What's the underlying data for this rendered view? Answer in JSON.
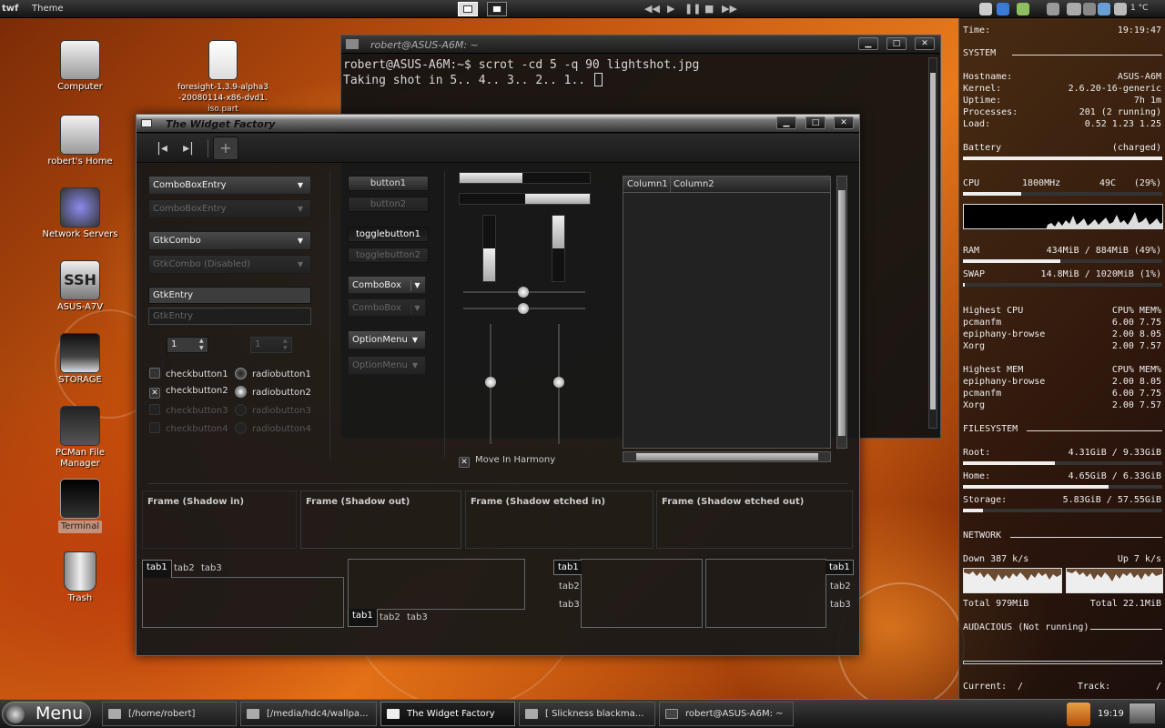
{
  "top_panel": {
    "app_label": "twf",
    "menu_label": "Theme",
    "temperature": "1 °C"
  },
  "desktop_icons": [
    {
      "label": "Computer",
      "icon": "computer-icon"
    },
    {
      "label": "foresight-1.3.9-alpha3-20080114-x86-dvd1.iso.part",
      "icon": "file-icon"
    },
    {
      "label": "robert's Home",
      "icon": "home-folder-icon"
    },
    {
      "label": "Network Servers",
      "icon": "network-icon"
    },
    {
      "label": "ASUS-A7V",
      "icon": "ssh-icon"
    },
    {
      "label": "STORAGE",
      "icon": "drive-icon"
    },
    {
      "label": "PCMan File Manager",
      "icon": "file-manager-icon"
    },
    {
      "label": "Terminal",
      "icon": "terminal-icon"
    },
    {
      "label": "Trash",
      "icon": "trash-icon"
    }
  ],
  "terminal": {
    "title": "robert@ASUS-A6M: ~",
    "lines": [
      "robert@ASUS-A6M:~$ scrot -cd 5 -q 90 lightshot.jpg",
      "Taking shot in 5.. 4.. 3.. 2.. 1.. "
    ]
  },
  "widget_factory": {
    "title": "The Widget Factory",
    "combo_entry": "ComboBoxEntry",
    "combo_entry_disabled": "ComboBoxEntry",
    "gtk_combo": "GtkCombo",
    "gtk_combo_disabled": "GtkCombo (Disabled)",
    "gtk_entry": "GtkEntry",
    "gtk_entry_disabled": "GtkEntry",
    "spin1": "1",
    "spin2": "1",
    "checks": [
      "checkbutton1",
      "checkbutton2",
      "checkbutton3",
      "checkbutton4"
    ],
    "radios": [
      "radiobutton1",
      "radiobutton2",
      "radiobutton3",
      "radiobutton4"
    ],
    "button1": "button1",
    "button2": "button2",
    "toggle1": "togglebutton1",
    "toggle2": "togglebutton2",
    "combobox1": "ComboBox",
    "combobox2": "ComboBox",
    "option1": "OptionMenu",
    "option2": "OptionMenu",
    "progress_h1": 0.48,
    "progress_h2": 0.5,
    "progress_v1": 0.5,
    "progress_v2": 0.5,
    "move_in_harmony": "Move In Harmony",
    "tree_columns": [
      "Column1",
      "Column2"
    ],
    "frames": [
      "Frame (Shadow in)",
      "Frame (Shadow out)",
      "Frame (Shadow etched in)",
      "Frame (Shadow etched out)"
    ],
    "tabs": [
      "tab1",
      "tab2",
      "tab3"
    ]
  },
  "conky": {
    "time_label": "Time:",
    "time": "19:19:47",
    "system_header": "SYSTEM",
    "hostname_label": "Hostname:",
    "hostname": "ASUS-A6M",
    "kernel_label": "Kernel:",
    "kernel": "2.6.20-16-generic",
    "uptime_label": "Uptime:",
    "uptime": "7h 1m",
    "processes_label": "Processes:",
    "processes": "201 (2 running)",
    "load_label": "Load:",
    "load": "0.52 1.23 1.25",
    "battery_label": "Battery",
    "battery": "(charged)",
    "battery_level": 1.0,
    "cpu_label": "CPU",
    "cpu_freq": "1800MHz",
    "cpu_temp": "49C",
    "cpu_pct": "(29%)",
    "cpu_level": 0.29,
    "ram_label": "RAM",
    "ram": "434MiB / 884MiB (49%)",
    "ram_level": 0.49,
    "swap_label": "SWAP",
    "swap": "14.8MiB / 1020MiB (1%)",
    "swap_level": 0.01,
    "highest_cpu_header": "Highest CPU",
    "cpu_cols": "CPU% MEM%",
    "highest_cpu": [
      {
        "name": "pcmanfm",
        "vals": "6.00  7.75"
      },
      {
        "name": "epiphany-browse",
        "vals": "2.00  8.05"
      },
      {
        "name": "Xorg",
        "vals": "2.00  7.57"
      }
    ],
    "highest_mem_header": "Highest MEM",
    "mem_cols": "CPU% MEM%",
    "highest_mem": [
      {
        "name": "epiphany-browse",
        "vals": "2.00  8.05"
      },
      {
        "name": "pcmanfm",
        "vals": "6.00  7.75"
      },
      {
        "name": "Xorg",
        "vals": "2.00  7.57"
      }
    ],
    "fs_header": "FILESYSTEM",
    "root_label": "Root:",
    "root": "4.31GiB / 9.33GiB",
    "root_level": 0.46,
    "home_label": "Home:",
    "home": "4.65GiB / 6.33GiB",
    "home_level": 0.73,
    "storage_label": "Storage:",
    "storage": "5.83GiB / 57.55GiB",
    "storage_level": 0.1,
    "net_header": "NETWORK",
    "down": "Down 387 k/s",
    "up": "Up 7 k/s",
    "total_down": "Total 979MiB",
    "total_up": "Total 22.1MiB",
    "audacious": "AUDACIOUS (Not running)",
    "current_label": "Current:",
    "current": "/",
    "track_label": "Track:",
    "track": "/"
  },
  "bottom_panel": {
    "menu_label": "Menu",
    "tasks": [
      "[/home/robert]",
      "[/media/hdc4/wallpa...",
      "The Widget Factory",
      "[ Slickness blackma...",
      "robert@ASUS-A6M: ~"
    ],
    "clock": "19:19"
  }
}
